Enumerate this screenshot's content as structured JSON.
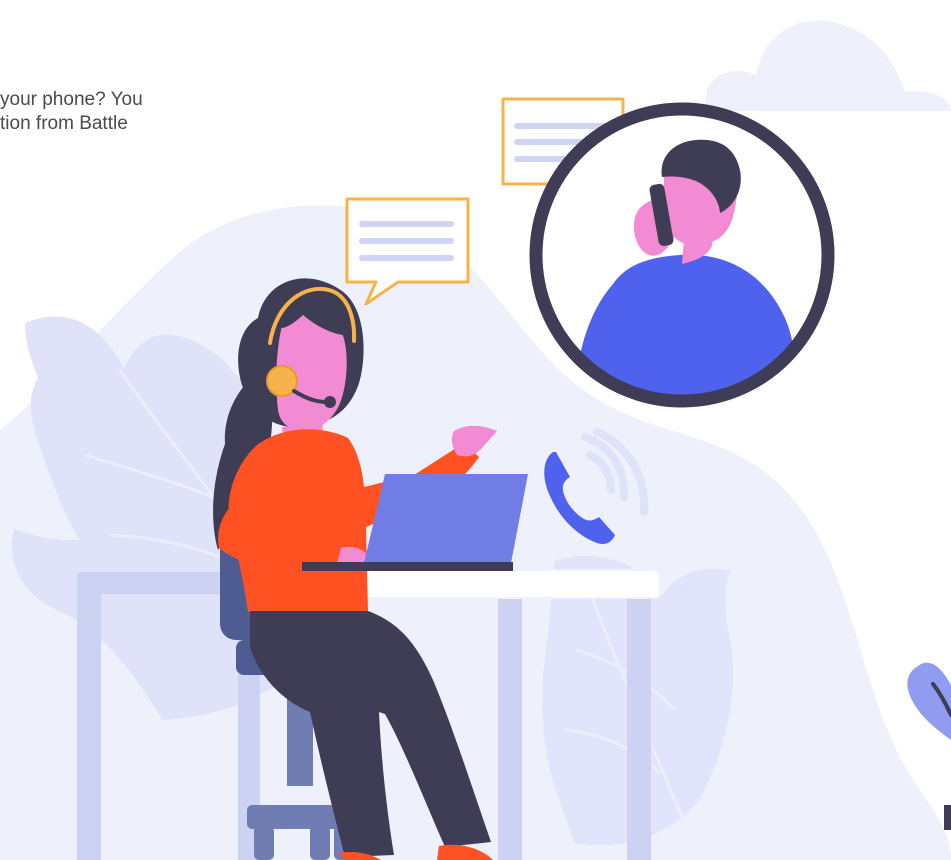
{
  "intro": {
    "line1": "your phone? You",
    "line2": "tion from Battle"
  },
  "colors": {
    "background_blob": "#eef0fb",
    "leaf": "#dcdff8",
    "desk": "#cdd2f3",
    "chair": "#4f5b93",
    "woman_shirt": "#ff5122",
    "woman_skin": "#f28bd3",
    "hair": "#3f3d56",
    "laptop": "#6f7de5",
    "phone_icon": "#4f62ee",
    "man_shirt": "#4f62ee",
    "bubble_border": "#f8b24b",
    "bubble_line": "#cfd4f5",
    "circle_border": "#3f3d56"
  },
  "icons": {
    "support_agent": "headset-agent-icon",
    "call": "phone-call-icon",
    "chat": "chat-bubble-icon"
  }
}
